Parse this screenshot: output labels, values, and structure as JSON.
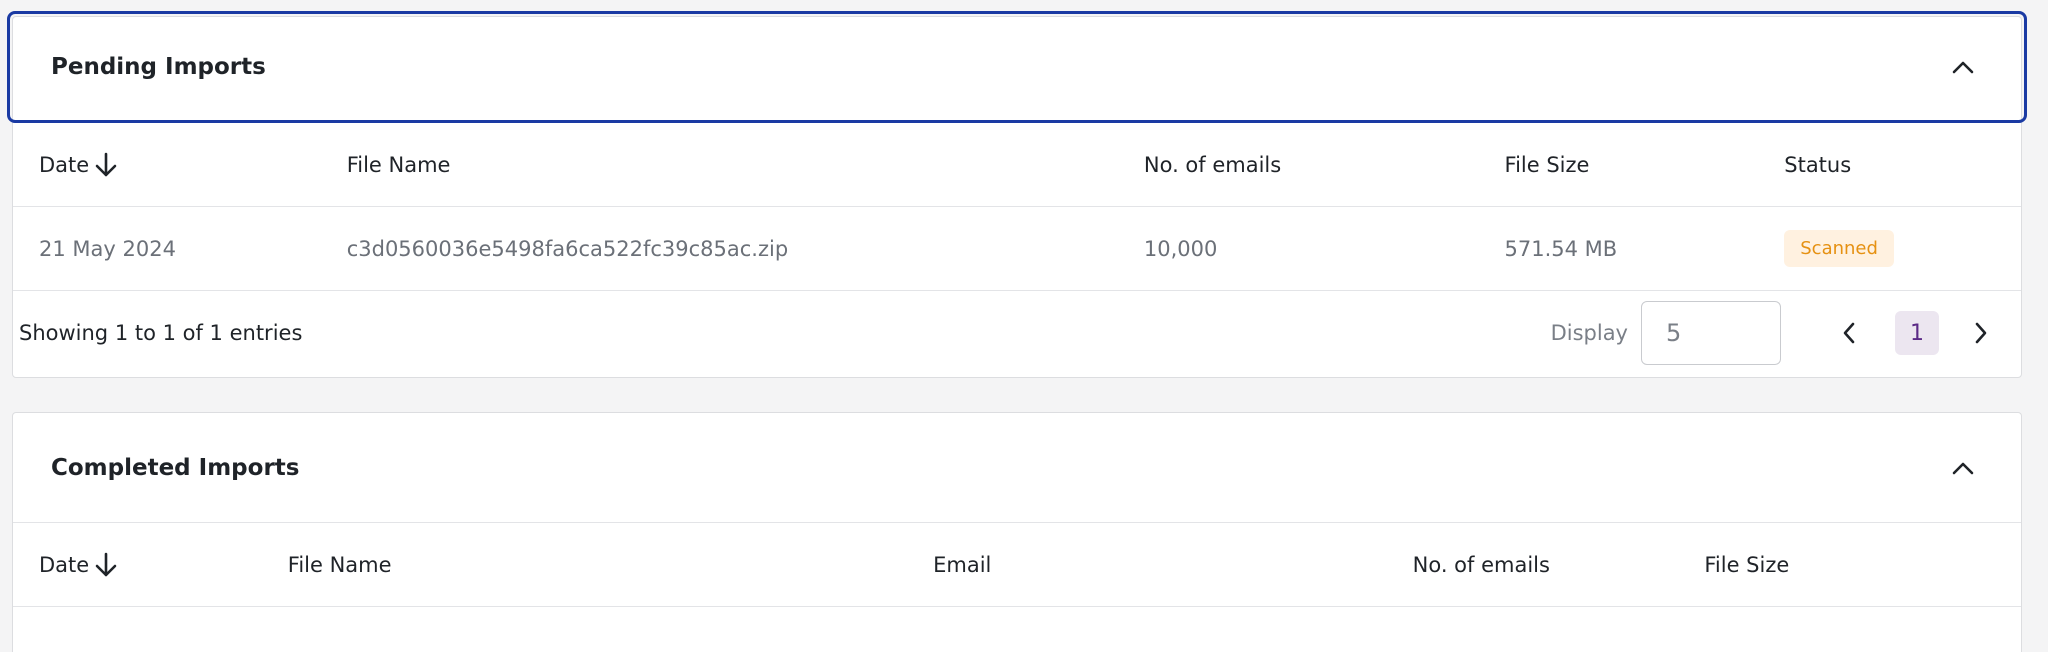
{
  "pending": {
    "title": "Pending Imports",
    "columns": {
      "date": "Date",
      "file_name": "File Name",
      "emails": "No. of emails",
      "size": "File Size",
      "status": "Status"
    },
    "rows": [
      {
        "date": "21 May 2024",
        "file_name": "c3d0560036e5498fa6ca522fc39c85ac.zip",
        "emails": "10,000",
        "size": "571.54 MB",
        "status": "Scanned"
      }
    ],
    "footer": {
      "entries": "Showing 1 to 1 of 1 entries",
      "display_label": "Display",
      "display_value": "5",
      "current_page": "1"
    }
  },
  "completed": {
    "title": "Completed Imports",
    "columns": {
      "date": "Date",
      "file_name": "File Name",
      "email": "Email",
      "emails": "No. of emails",
      "size": "File Size"
    }
  },
  "colors": {
    "focus_border": "#1a3aa3",
    "badge_bg": "#fff1e0",
    "badge_text": "#e69112",
    "page_active_bg": "#ece6f0",
    "page_active_text": "#5b2a86"
  },
  "icons": {
    "collapse": "chevron-up-icon",
    "sort": "arrow-down-icon",
    "prev": "chevron-left-icon",
    "next": "chevron-right-icon"
  }
}
